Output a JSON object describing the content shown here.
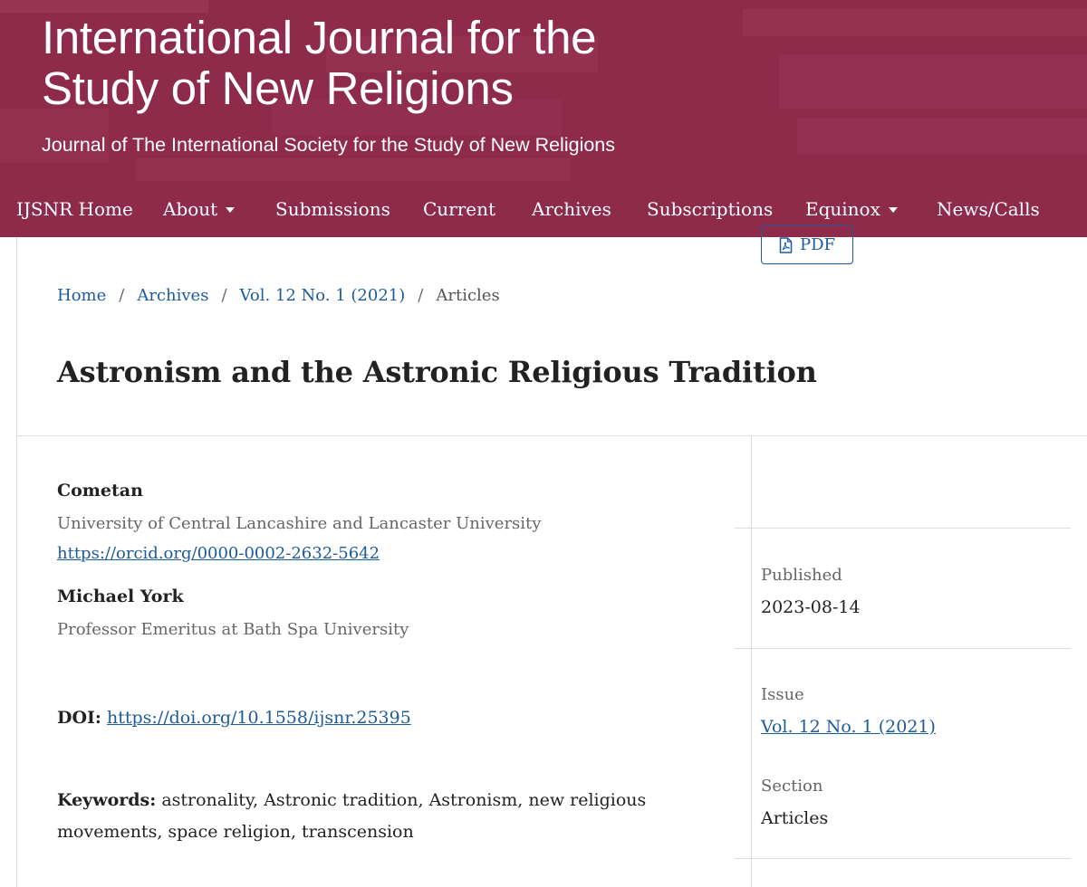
{
  "header": {
    "title": "International Journal for the\nStudy of New Religions",
    "subtitle": "Journal of The International Society for the Study of New Religions"
  },
  "nav": {
    "items": [
      {
        "label": "IJSNR Home"
      },
      {
        "label": "About"
      },
      {
        "label": "Submissions"
      },
      {
        "label": "Current"
      },
      {
        "label": "Archives"
      },
      {
        "label": "Subscriptions"
      },
      {
        "label": "Equinox"
      },
      {
        "label": "News/Calls"
      }
    ]
  },
  "breadcrumb": {
    "home": "Home",
    "archives": "Archives",
    "issue": "Vol. 12 No. 1 (2021)",
    "current": "Articles",
    "separator": "/"
  },
  "article": {
    "title": "Astronism and the Astronic Religious Tradition",
    "authors": [
      {
        "name": "Cometan",
        "affiliation": "University of Central Lancashire and Lancaster University",
        "orcid": "https://orcid.org/0000-0002-2632-5642"
      },
      {
        "name": "Michael York",
        "affiliation": "Professor Emeritus at Bath Spa University"
      }
    ],
    "doi_label": "DOI:",
    "doi": "https://doi.org/10.1558/ijsnr.25395",
    "keywords_label": "Keywords:",
    "keywords": "astronality, Astronic tradition, Astronism, new religious movements, space religion, transcension"
  },
  "sidebar": {
    "pdf_label": "PDF",
    "published_label": "Published",
    "published_date": "2023-08-14",
    "issue_label": "Issue",
    "issue_value": "Vol. 12 No. 1 (2021)",
    "section_label": "Section",
    "section_value": "Articles"
  },
  "colors": {
    "brand": "#8e2a4a",
    "link": "#1d5b9a"
  }
}
